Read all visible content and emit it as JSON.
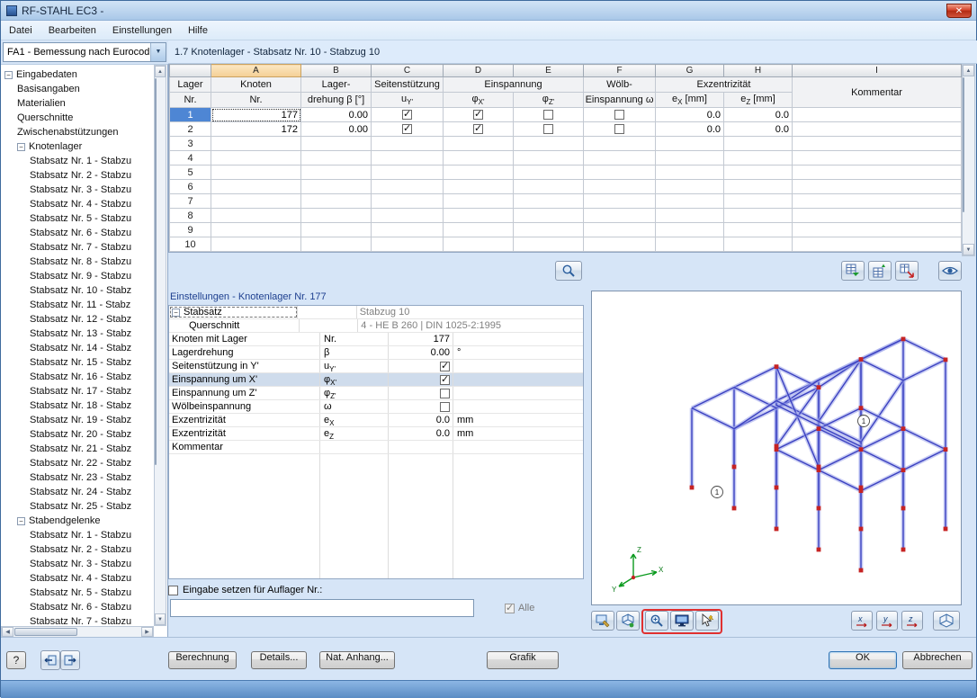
{
  "window": {
    "title": "RF-STAHL EC3 -",
    "menu": [
      "Datei",
      "Bearbeiten",
      "Einstellungen",
      "Hilfe"
    ],
    "case_dropdown": "FA1 - Bemessung nach Eurocod",
    "section_title": "1.7 Knotenlager - Stabsatz Nr. 10 - Stabzug 10"
  },
  "sidebar": {
    "root": "Eingabedaten",
    "items_before": [
      "Basisangaben",
      "Materialien",
      "Querschnitte",
      "Zwischenabstützungen"
    ],
    "knotenlager": {
      "label": "Knotenlager",
      "children": [
        "Stabsatz Nr. 1 - Stabzu",
        "Stabsatz Nr. 2 - Stabzu",
        "Stabsatz Nr. 3 - Stabzu",
        "Stabsatz Nr. 4 - Stabzu",
        "Stabsatz Nr. 5 - Stabzu",
        "Stabsatz Nr. 6 - Stabzu",
        "Stabsatz Nr. 7 - Stabzu",
        "Stabsatz Nr. 8 - Stabzu",
        "Stabsatz Nr. 9 - Stabzu",
        "Stabsatz Nr. 10 - Stabz",
        "Stabsatz Nr. 11 - Stabz",
        "Stabsatz Nr. 12 - Stabz",
        "Stabsatz Nr. 13 - Stabz",
        "Stabsatz Nr. 14 - Stabz",
        "Stabsatz Nr. 15 - Stabz",
        "Stabsatz Nr. 16 - Stabz",
        "Stabsatz Nr. 17 - Stabz",
        "Stabsatz Nr. 18 - Stabz",
        "Stabsatz Nr. 19 - Stabz",
        "Stabsatz Nr. 20 - Stabz",
        "Stabsatz Nr. 21 - Stabz",
        "Stabsatz Nr. 22 - Stabz",
        "Stabsatz Nr. 23 - Stabz",
        "Stabsatz Nr. 24 - Stabz",
        "Stabsatz Nr. 25 - Stabz"
      ]
    },
    "stabendgelenke": {
      "label": "Stabendgelenke",
      "children": [
        "Stabsatz Nr. 1 - Stabzu",
        "Stabsatz Nr. 2 - Stabzu",
        "Stabsatz Nr. 3 - Stabzu",
        "Stabsatz Nr. 4 - Stabzu",
        "Stabsatz Nr. 5 - Stabzu",
        "Stabsatz Nr. 6 - Stabzu",
        "Stabsatz Nr. 7 - Stabzu"
      ]
    }
  },
  "table": {
    "letters": [
      "A",
      "B",
      "C",
      "D",
      "E",
      "F",
      "G",
      "H",
      "I"
    ],
    "headers": {
      "lager": [
        "Lager",
        "Nr."
      ],
      "knoten": [
        "Knoten",
        "Nr."
      ],
      "drehung": [
        "Lager-",
        "drehung β [°]"
      ],
      "seiten": [
        "Seitenstützung",
        "u",
        "Y'"
      ],
      "einspannung": "Einspannung",
      "phix": [
        "φ",
        "X'"
      ],
      "phiz": [
        "φ",
        "Z'"
      ],
      "woelb": [
        "Wölb-",
        "Einspannung ω"
      ],
      "exz": "Exzentrizität",
      "ex": [
        "e",
        "X",
        "[mm]"
      ],
      "ez": [
        "e",
        "Z",
        "[mm]"
      ],
      "kommentar": "Kommentar"
    },
    "rows": [
      {
        "nr": "1",
        "knoten": "177",
        "beta": "0.00",
        "uy": true,
        "phix": true,
        "phiz": false,
        "woelb": false,
        "ex": "0.0",
        "ez": "0.0",
        "kommentar": ""
      },
      {
        "nr": "2",
        "knoten": "172",
        "beta": "0.00",
        "uy": true,
        "phix": true,
        "phiz": false,
        "woelb": false,
        "ex": "0.0",
        "ez": "0.0",
        "kommentar": ""
      }
    ],
    "empty_row_numbers": [
      "3",
      "4",
      "5",
      "6",
      "7",
      "8",
      "9",
      "10"
    ]
  },
  "settings": {
    "title": "Einstellungen - Knotenlager Nr. 177",
    "rows": [
      {
        "label": "Stabsatz",
        "type": "group",
        "value": "Stabzug 10"
      },
      {
        "label": "Querschnitt",
        "type": "sub",
        "value": "4 - HE B 260 | DIN 1025-2:1995"
      },
      {
        "label": "Knoten mit Lager",
        "sym": "Nr.",
        "sub": "",
        "type": "text",
        "value": "177",
        "unit": ""
      },
      {
        "label": "Lagerdrehung",
        "sym": "β",
        "sub": "",
        "type": "text",
        "value": "0.00",
        "unit": "°"
      },
      {
        "label": "Seitenstützung in Y'",
        "sym": "u",
        "sub": "Y'",
        "type": "check",
        "checked": true
      },
      {
        "label": "Einspannung um X'",
        "sym": "φ",
        "sub": "X'",
        "type": "check",
        "checked": true,
        "highlight": true
      },
      {
        "label": "Einspannung um Z'",
        "sym": "φ",
        "sub": "Z'",
        "type": "check",
        "checked": false
      },
      {
        "label": "Wölbeinspannung",
        "sym": "ω",
        "sub": "",
        "type": "check",
        "checked": false
      },
      {
        "label": "Exzentrizität",
        "sym": "e",
        "sub": "X",
        "type": "text",
        "value": "0.0",
        "unit": "mm"
      },
      {
        "label": "Exzentrizität",
        "sym": "e",
        "sub": "Z",
        "type": "text",
        "value": "0.0",
        "unit": "mm"
      },
      {
        "label": "Kommentar",
        "sym": "",
        "sub": "",
        "type": "text",
        "value": "",
        "unit": ""
      }
    ],
    "footer": {
      "checkbox_label": "Eingabe setzen für Auflager Nr.:",
      "alle_label": "Alle",
      "input_value": ""
    }
  },
  "graphic": {
    "axis_labels": [
      "X",
      "Y",
      "Z"
    ],
    "markers": [
      "1",
      "1"
    ]
  },
  "footerbar": {
    "buttons": [
      "Berechnung",
      "Details...",
      "Nat. Anhang...",
      "Grafik"
    ],
    "ok": "OK",
    "cancel": "Abbrechen"
  }
}
